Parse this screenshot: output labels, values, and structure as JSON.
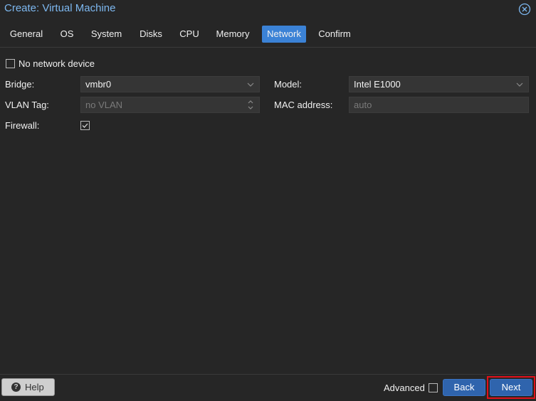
{
  "window": {
    "title": "Create: Virtual Machine",
    "close_icon": "close-circle-icon"
  },
  "tabs": [
    {
      "label": "General"
    },
    {
      "label": "OS"
    },
    {
      "label": "System"
    },
    {
      "label": "Disks"
    },
    {
      "label": "CPU"
    },
    {
      "label": "Memory"
    },
    {
      "label": "Network",
      "active": true
    },
    {
      "label": "Confirm"
    }
  ],
  "form": {
    "no_network": {
      "label": "No network device",
      "checked": false
    },
    "bridge": {
      "label": "Bridge:",
      "value": "vmbr0"
    },
    "model": {
      "label": "Model:",
      "value": "Intel E1000"
    },
    "vlan": {
      "label": "VLAN Tag:",
      "placeholder": "no VLAN"
    },
    "mac": {
      "label": "MAC address:",
      "placeholder": "auto"
    },
    "firewall": {
      "label": "Firewall:",
      "checked": true
    }
  },
  "footer": {
    "help_label": "Help",
    "advanced_label": "Advanced",
    "advanced_checked": false,
    "back_label": "Back",
    "next_label": "Next"
  },
  "colors": {
    "background": "#262626",
    "title": "#7db8f0",
    "accent": "#3b82d6",
    "primary_button": "#2f64ad",
    "highlight": "#e0101a"
  }
}
